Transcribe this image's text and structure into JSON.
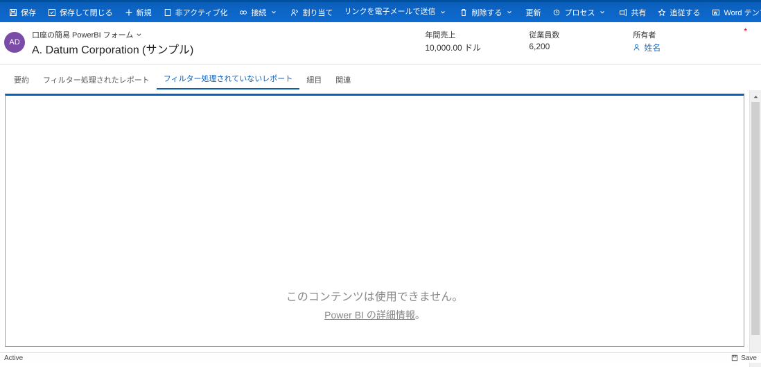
{
  "ribbon": {
    "save": "保存",
    "saveClose": "保存して閉じる",
    "new": "新規",
    "deactivate": "非アクティブ化",
    "connect": "接続",
    "assign": "割り当て",
    "emailLink": "リンクを電子メールで送信",
    "delete": "削除する",
    "refresh": "更新",
    "process": "プロセス",
    "share": "共有",
    "follow": "追従する",
    "word": "Word テンプレート"
  },
  "record": {
    "avatar": "AD",
    "formName": "口座の簡易 PowerBI フォーム",
    "title": "A. Datum Corporation (サンプル)",
    "kv1Label": "年間売上",
    "kv1Val": "10,000.00 ドル",
    "kv2Label": "従業員数",
    "kv2Val": "6,200",
    "ownerLabel": "所有者",
    "ownerVal": "姓名"
  },
  "tabs": {
    "t0": "要約",
    "t1": "フィルター処理されたレポート",
    "t2": "フィルター処理されていないレポート",
    "t3": "細目",
    "t4": "関連"
  },
  "report": {
    "unavailable": "このコンテンツは使用できません。",
    "learnPrefix": "Power BI の詳細情報",
    "learnSuffix": "。"
  },
  "status": {
    "left": "Active",
    "save": "Save"
  }
}
